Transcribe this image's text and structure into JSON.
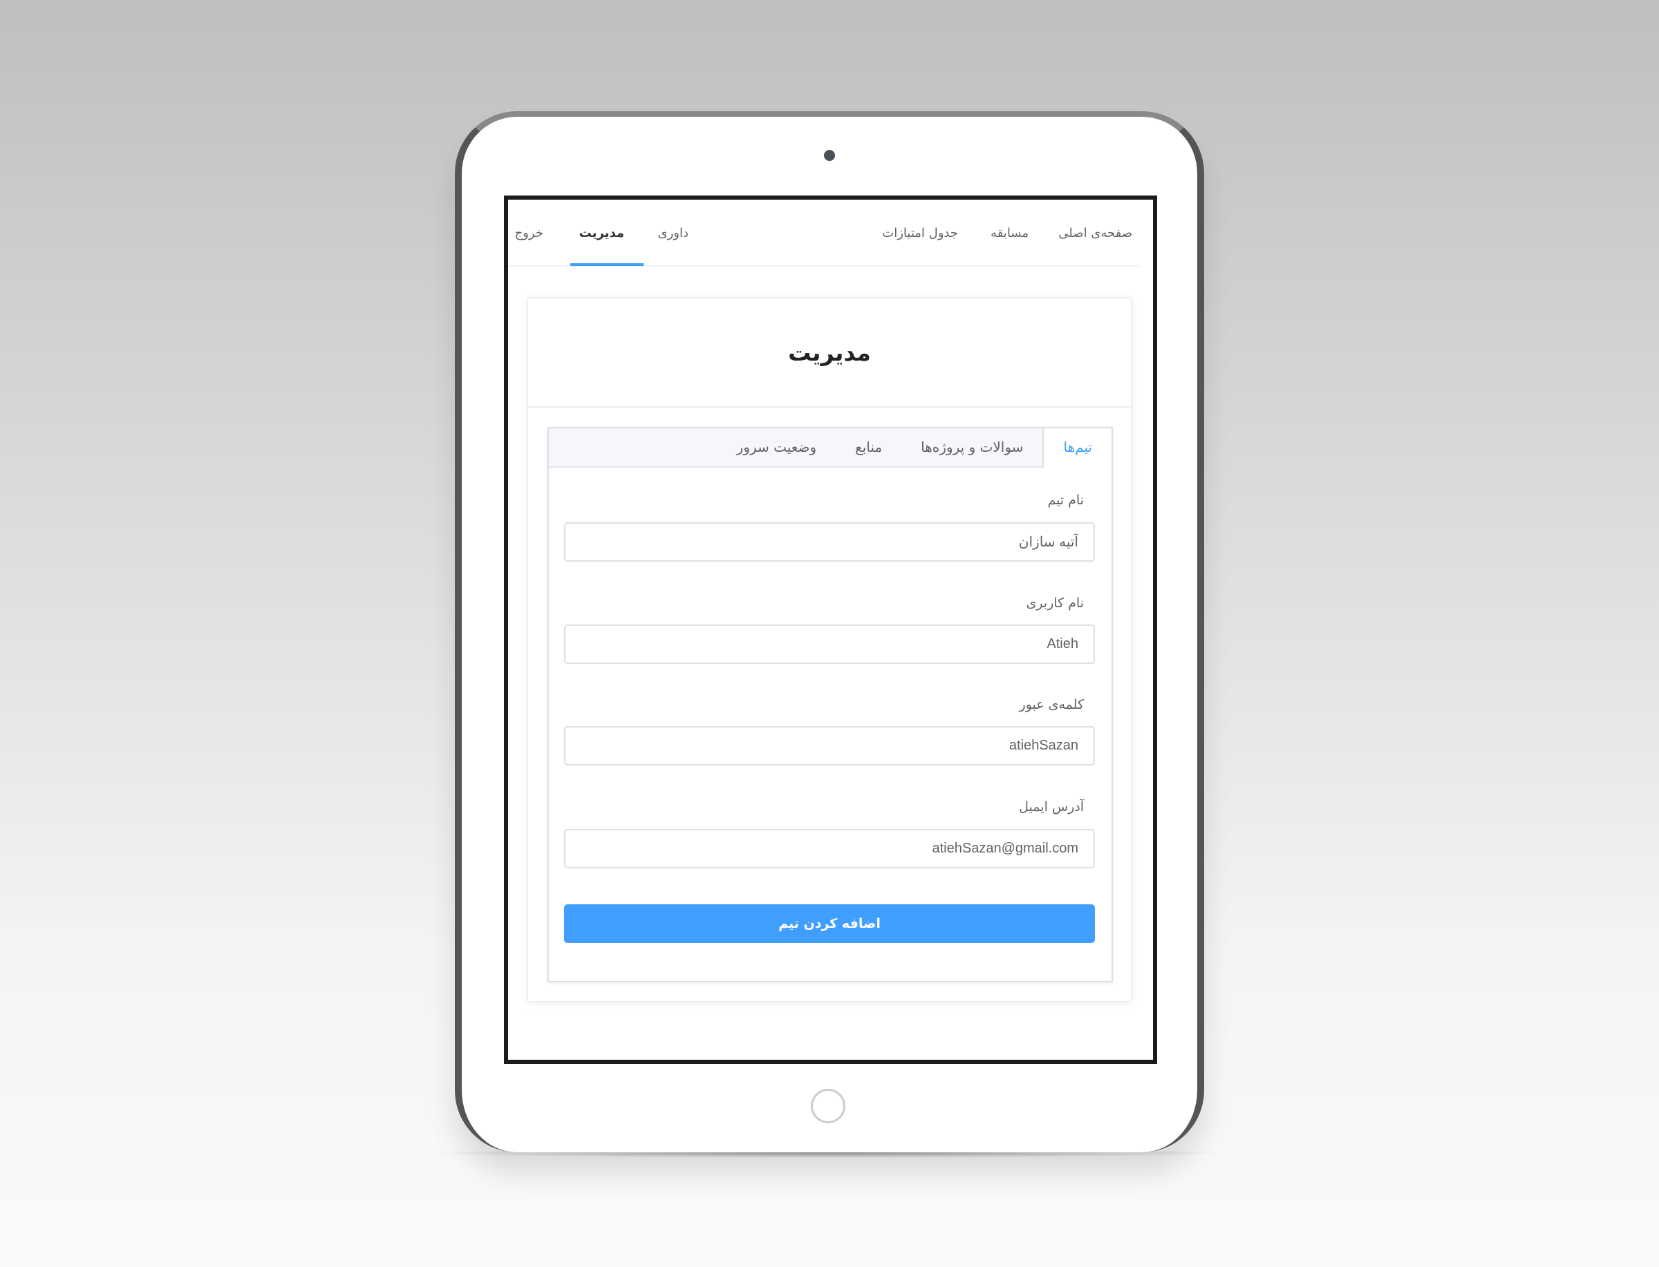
{
  "nav": {
    "items": [
      "صفحه‌ی اصلی",
      "مسابقه",
      "جدول امتیازات",
      "داوری",
      "مدیریت",
      "خروج"
    ],
    "active": "مدیریت"
  },
  "card": {
    "title": "مدیریت"
  },
  "tabs": [
    "تیم‌ها",
    "سوالات و پروژه‌ها",
    "منابع",
    "وضعیت سرور"
  ],
  "form": {
    "team_name": {
      "label": "نام تیم",
      "value": "آتیه سازان"
    },
    "username": {
      "label": "نام کاربری",
      "value": "Atieh"
    },
    "password": {
      "label": "کلمه‌ی عبور",
      "value": "atiehSazan"
    },
    "email": {
      "label": "آدرس ایمیل",
      "value": "atiehSazan@gmail.com"
    },
    "submit_label": "اضافه کردن تیم"
  },
  "colors": {
    "accent": "#409eff"
  }
}
